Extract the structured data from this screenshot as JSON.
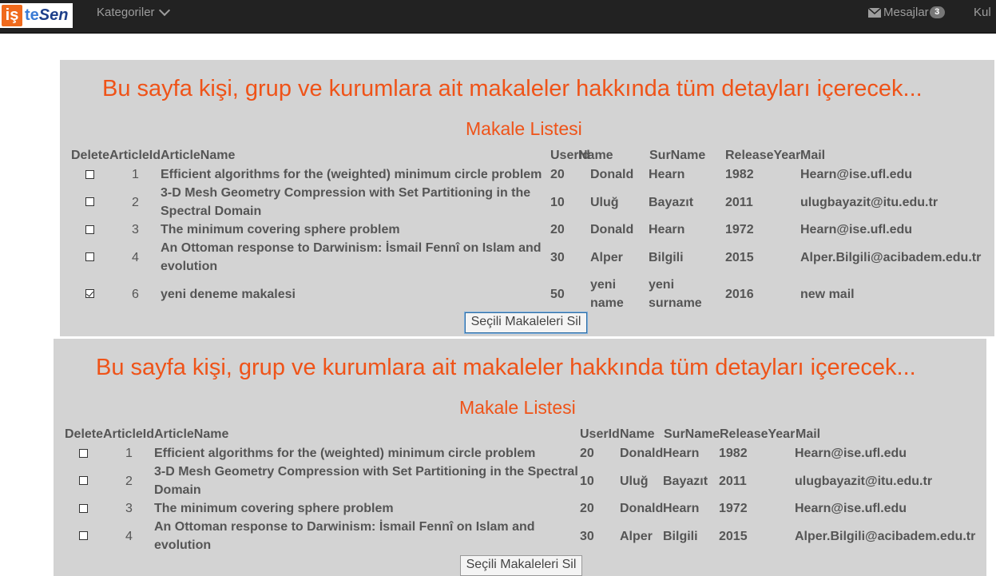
{
  "nav": {
    "logo": {
      "part1": "iş",
      "part2": "te",
      "part3": "Sen"
    },
    "kategoriler": "Kategoriler",
    "mesajlar": "Mesajlar",
    "mesaj_count": "3",
    "kullanici": "Kul"
  },
  "panels": [
    {
      "title": "Bu sayfa kişi, grup ve kurumlara ait makaleler hakkında tüm detayları içerecek...",
      "subtitle": "Makale Listesi",
      "headers": [
        "Delete",
        "ArticleId",
        "ArticleName",
        "UserId",
        "Name",
        "SurName",
        "ReleaseYear",
        "Mail"
      ],
      "rows": [
        {
          "checked": false,
          "id": "1",
          "name_lines": [
            "Efficient algorithms for the (weighted) minimum circle problem"
          ],
          "userid": "20",
          "name_lines2": [
            "Donald"
          ],
          "surname_lines": [
            "Hearn"
          ],
          "year": "1982",
          "mail": "Hearn@ise.ufl.edu"
        },
        {
          "checked": false,
          "id": "2",
          "name_lines": [
            "3-D Mesh Geometry Compression with Set Partitioning in the",
            "Spectral Domain"
          ],
          "userid": "10",
          "name_lines2": [
            "Uluğ"
          ],
          "surname_lines": [
            "Bayazıt"
          ],
          "year": "2011",
          "mail": "ulugbayazit@itu.edu.tr"
        },
        {
          "checked": false,
          "id": "3",
          "name_lines": [
            "The minimum covering sphere problem"
          ],
          "userid": "20",
          "name_lines2": [
            "Donald"
          ],
          "surname_lines": [
            "Hearn"
          ],
          "year": "1972",
          "mail": "Hearn@ise.ufl.edu"
        },
        {
          "checked": false,
          "id": "4",
          "name_lines": [
            "An Ottoman response to Darwinism: İsmail Fennî on Islam and",
            "evolution"
          ],
          "userid": "30",
          "name_lines2": [
            "Alper"
          ],
          "surname_lines": [
            "Bilgili"
          ],
          "year": "2015",
          "mail": "Alper.Bilgili@acibadem.edu.tr"
        },
        {
          "checked": true,
          "id": "6",
          "name_lines": [
            "yeni deneme makalesi"
          ],
          "userid": "50",
          "name_lines2": [
            "yeni",
            "name"
          ],
          "surname_lines": [
            "yeni",
            "surname"
          ],
          "year": "2016",
          "mail": "new mail"
        }
      ],
      "button": "Seçili Makaleleri Sil"
    },
    {
      "title": "Bu sayfa kişi, grup ve kurumlara ait makaleler hakkında tüm detayları içerecek...",
      "subtitle": "Makale Listesi",
      "headers": [
        "Delete",
        "ArticleId",
        "ArticleName",
        "UserId",
        "Name",
        "SurName",
        "ReleaseYear",
        "Mail"
      ],
      "rows": [
        {
          "checked": false,
          "id": "1",
          "name_lines": [
            "Efficient algorithms for the (weighted) minimum circle problem"
          ],
          "userid": "20",
          "name_lines2": [
            "Donald"
          ],
          "surname_lines": [
            "Hearn"
          ],
          "year": "1982",
          "mail": "Hearn@ise.ufl.edu"
        },
        {
          "checked": false,
          "id": "2",
          "name_lines": [
            "3-D Mesh Geometry Compression with Set Partitioning in the Spectral",
            "Domain"
          ],
          "userid": "10",
          "name_lines2": [
            "Uluğ"
          ],
          "surname_lines": [
            "Bayazıt"
          ],
          "year": "2011",
          "mail": "ulugbayazit@itu.edu.tr"
        },
        {
          "checked": false,
          "id": "3",
          "name_lines": [
            "The minimum covering sphere problem"
          ],
          "userid": "20",
          "name_lines2": [
            "Donald"
          ],
          "surname_lines": [
            "Hearn"
          ],
          "year": "1972",
          "mail": "Hearn@ise.ufl.edu"
        },
        {
          "checked": false,
          "id": "4",
          "name_lines": [
            "An Ottoman response to Darwinism: İsmail Fennî on Islam and",
            "evolution"
          ],
          "userid": "30",
          "name_lines2": [
            "Alper"
          ],
          "surname_lines": [
            "Bilgili"
          ],
          "year": "2015",
          "mail": "Alper.Bilgili@acibadem.edu.tr"
        }
      ],
      "button": "Seçili Makaleleri Sil"
    }
  ]
}
